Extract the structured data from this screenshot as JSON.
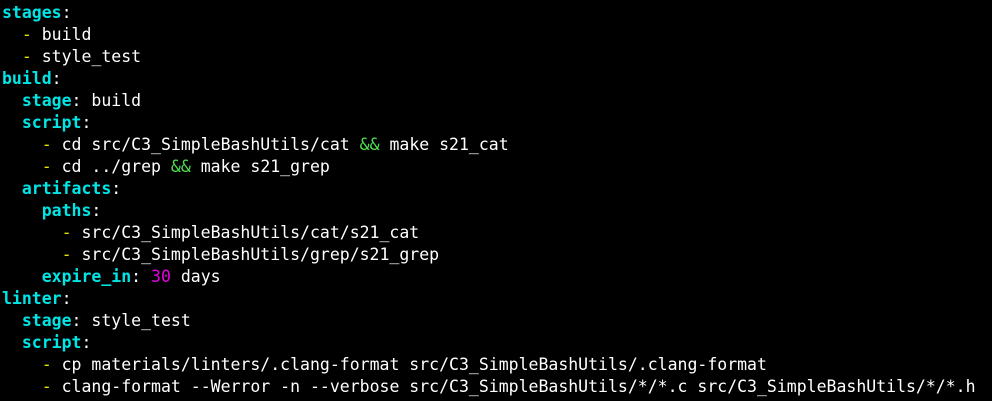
{
  "colors": {
    "background": "#000000",
    "key": "#00e5e5",
    "text": "#ffffff",
    "dash": "#e5e500",
    "number": "#e500e5",
    "operator": "#4ee04e"
  },
  "lines": [
    [
      {
        "t": "stages",
        "c": "k"
      },
      {
        "t": ":",
        "c": "c"
      }
    ],
    [
      {
        "t": "  ",
        "c": "w"
      },
      {
        "t": "-",
        "c": "d"
      },
      {
        "t": " build",
        "c": "w"
      }
    ],
    [
      {
        "t": "  ",
        "c": "w"
      },
      {
        "t": "-",
        "c": "d"
      },
      {
        "t": " style_test",
        "c": "w"
      }
    ],
    [
      {
        "t": "build",
        "c": "k"
      },
      {
        "t": ":",
        "c": "c"
      }
    ],
    [
      {
        "t": "  ",
        "c": "w"
      },
      {
        "t": "stage",
        "c": "k"
      },
      {
        "t": ":",
        "c": "c"
      },
      {
        "t": " build",
        "c": "w"
      }
    ],
    [
      {
        "t": "  ",
        "c": "w"
      },
      {
        "t": "script",
        "c": "k"
      },
      {
        "t": ":",
        "c": "c"
      }
    ],
    [
      {
        "t": "    ",
        "c": "w"
      },
      {
        "t": "-",
        "c": "d"
      },
      {
        "t": " cd src/C3_SimpleBashUtils/cat ",
        "c": "w"
      },
      {
        "t": "&&",
        "c": "a"
      },
      {
        "t": " make s21_cat",
        "c": "w"
      }
    ],
    [
      {
        "t": "    ",
        "c": "w"
      },
      {
        "t": "-",
        "c": "d"
      },
      {
        "t": " cd ../grep ",
        "c": "w"
      },
      {
        "t": "&&",
        "c": "a"
      },
      {
        "t": " make s21_grep",
        "c": "w"
      }
    ],
    [
      {
        "t": "  ",
        "c": "w"
      },
      {
        "t": "artifacts",
        "c": "k"
      },
      {
        "t": ":",
        "c": "c"
      }
    ],
    [
      {
        "t": "    ",
        "c": "w"
      },
      {
        "t": "paths",
        "c": "k"
      },
      {
        "t": ":",
        "c": "c"
      }
    ],
    [
      {
        "t": "      ",
        "c": "w"
      },
      {
        "t": "-",
        "c": "d"
      },
      {
        "t": " src/C3_SimpleBashUtils/cat/s21_cat",
        "c": "w"
      }
    ],
    [
      {
        "t": "      ",
        "c": "w"
      },
      {
        "t": "-",
        "c": "d"
      },
      {
        "t": " src/C3_SimpleBashUtils/grep/s21_grep",
        "c": "w"
      }
    ],
    [
      {
        "t": "    ",
        "c": "w"
      },
      {
        "t": "expire_in",
        "c": "k"
      },
      {
        "t": ":",
        "c": "c"
      },
      {
        "t": " ",
        "c": "w"
      },
      {
        "t": "30",
        "c": "n"
      },
      {
        "t": " days",
        "c": "w"
      }
    ],
    [
      {
        "t": "linter",
        "c": "k"
      },
      {
        "t": ":",
        "c": "c"
      }
    ],
    [
      {
        "t": "  ",
        "c": "w"
      },
      {
        "t": "stage",
        "c": "k"
      },
      {
        "t": ":",
        "c": "c"
      },
      {
        "t": " style_test",
        "c": "w"
      }
    ],
    [
      {
        "t": "  ",
        "c": "w"
      },
      {
        "t": "script",
        "c": "k"
      },
      {
        "t": ":",
        "c": "c"
      }
    ],
    [
      {
        "t": "    ",
        "c": "w"
      },
      {
        "t": "-",
        "c": "d"
      },
      {
        "t": " cp materials/linters/.clang-format src/C3_SimpleBashUtils/.clang-format",
        "c": "w"
      }
    ],
    [
      {
        "t": "    ",
        "c": "w"
      },
      {
        "t": "-",
        "c": "d"
      },
      {
        "t": " clang-format --Werror -n --verbose src/C3_SimpleBashUtils/*/*.c src/C3_SimpleBashUtils/*/*.h",
        "c": "w"
      }
    ]
  ]
}
